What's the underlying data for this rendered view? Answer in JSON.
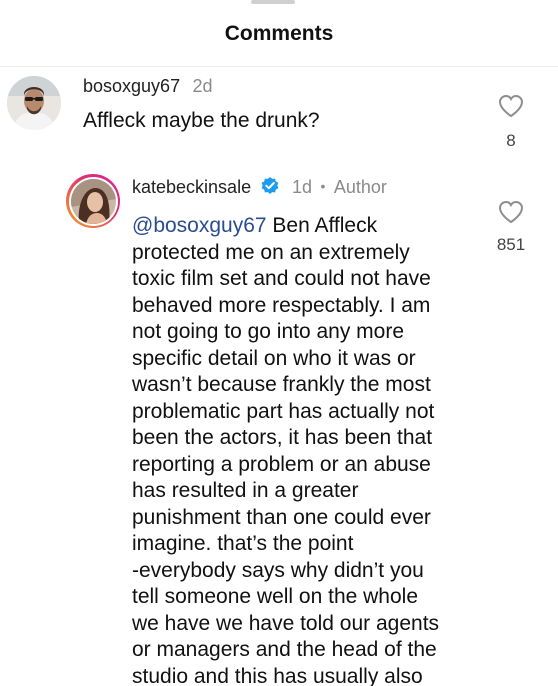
{
  "header": {
    "title": "Comments"
  },
  "comments": [
    {
      "username": "bosoxguy67",
      "time": "2d",
      "text": "Affleck maybe the drunk?",
      "likes": "8",
      "avatar_icon": "profile-photo"
    },
    {
      "username": "katebeckinsale",
      "verified": true,
      "time": "1d",
      "separator": "•",
      "role": "Author",
      "mention": "@bosoxguy67",
      "text_lines": [
        " Ben Affleck",
        "protected me on an extremely",
        "toxic film set and could not have",
        "behaved more respectably. I am",
        "not going to go into any more",
        "specific detail on who it was or",
        "wasn’t because frankly the most",
        "problematic part has actually not",
        "been the actors, it has been that",
        "reporting a problem or an  abuse",
        "has resulted in a greater",
        "punishment than one could ever",
        "imagine. that’s the point",
        "-everybody says why didn’t you",
        "tell someone well on the whole",
        "we have we have told our  agents",
        "or managers and the head of the",
        "studio and this has usually also"
      ],
      "likes": "851",
      "avatar_icon": "profile-photo-story-ring"
    }
  ],
  "colors": {
    "verified_badge": "#1d9bf0",
    "mention": "#2a4d8f",
    "story_ring_start": "#f5a623",
    "story_ring_end": "#d6249f"
  }
}
